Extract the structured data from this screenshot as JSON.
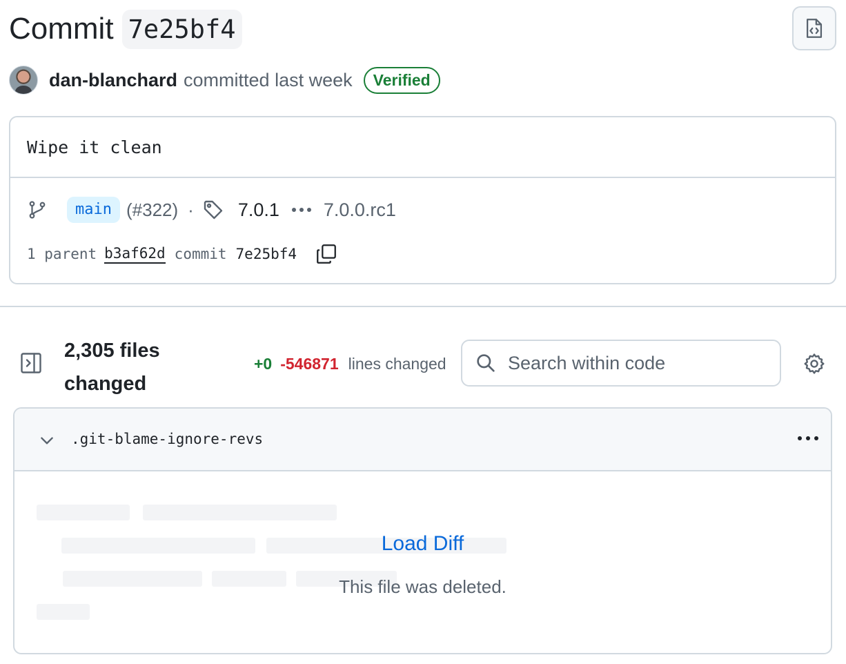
{
  "header": {
    "title_word": "Commit",
    "commit_sha": "7e25bf4",
    "author": "dan-blanchard",
    "committed_text": "committed last week",
    "verified_label": "Verified"
  },
  "commit": {
    "message": "Wipe it clean",
    "branch": "main",
    "pr_number": "(#322)",
    "separator": "·",
    "tag_latest": "7.0.1",
    "tag_oldest": "7.0.0.rc1",
    "parent_label": "1 parent",
    "parent_sha": "b3af62d",
    "commit_label": "commit",
    "commit_sha": "7e25bf4"
  },
  "files": {
    "count_label": "2,305 files changed",
    "additions": "+0",
    "deletions": "-546871",
    "lines_label": "lines changed",
    "search_placeholder": "Search within code"
  },
  "file_card": {
    "file_name": ".git-blame-ignore-revs",
    "load_diff_label": "Load Diff",
    "status_text": "This file was deleted."
  },
  "icons": {
    "browse": "file-code-icon",
    "branch": "git-branch-icon",
    "tag": "tag-icon",
    "copy": "copy-icon",
    "sidebar": "sidebar-expand-icon",
    "search": "search-icon",
    "settings": "gear-icon",
    "collapse": "chevron-down-icon",
    "menu": "kebab-menu-icon"
  },
  "colors": {
    "accent": "#0969da",
    "success": "#1a7f37",
    "danger": "#d1242f",
    "muted": "#59636e",
    "border": "#d1d9e0"
  }
}
